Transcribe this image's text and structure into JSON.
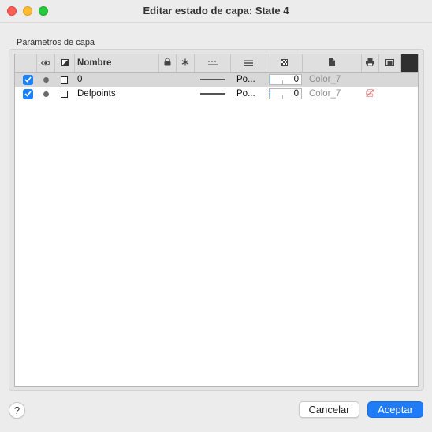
{
  "window": {
    "title": "Editar estado de capa: State 4"
  },
  "group": {
    "label": "Parámetros de capa"
  },
  "table": {
    "columns": {
      "name": "Nombre"
    },
    "rows": [
      {
        "checked": true,
        "name": "0",
        "plot_style": "Po...",
        "transparency": "0",
        "color": "Color_7",
        "plot": "printer",
        "selected": true
      },
      {
        "checked": true,
        "name": "Defpoints",
        "plot_style": "Po...",
        "transparency": "0",
        "color": "Color_7",
        "plot": "no-print",
        "selected": false
      }
    ]
  },
  "buttons": {
    "help": "?",
    "cancel": "Cancelar",
    "accept": "Aceptar"
  },
  "colors": {
    "accent": "#1f7cf6",
    "selected_row": "#d8d8d8",
    "header": "#dfdfdf"
  },
  "icons": {
    "visibility": "eye-icon",
    "color_header": "color-swatch-icon",
    "lock": "lock-icon",
    "freeze": "snowflake-icon",
    "linetype": "linetype-icon",
    "lineweight": "lineweight-icon",
    "transparency": "transparency-icon",
    "plot_style": "document-icon",
    "plot": "printer-icon",
    "new_vp_freeze": "viewport-icon",
    "no_plot": "no-print-icon"
  }
}
